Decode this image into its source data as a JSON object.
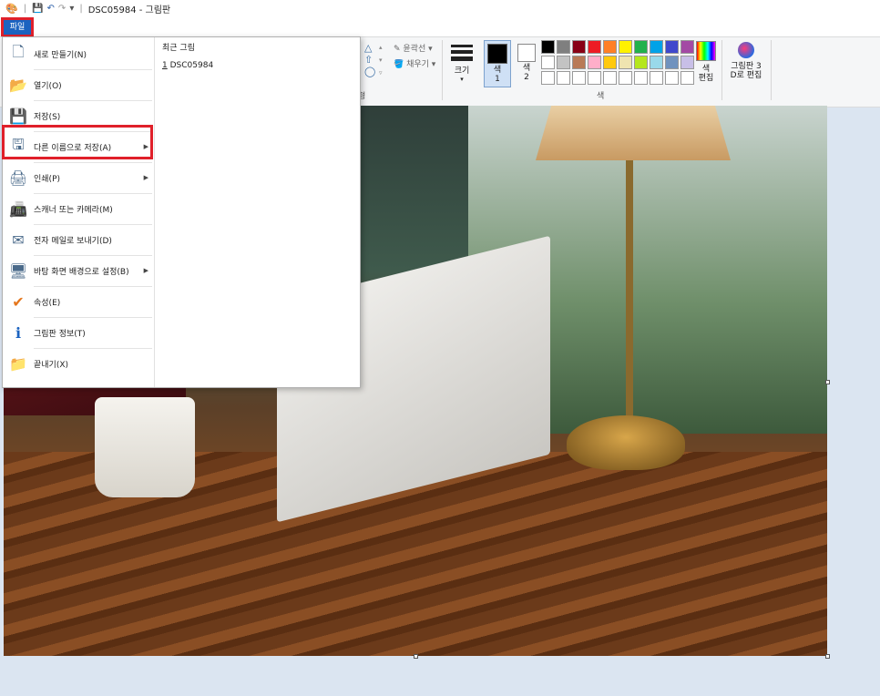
{
  "window": {
    "title": "DSC05984 - 그림판"
  },
  "ribbon": {
    "file_tab": "파일",
    "outline_label": "윤곽선",
    "fill_label": "채우기",
    "shapes_group": "형",
    "size_label": "크기",
    "color1_label": "색\n1",
    "color2_label": "색\n2",
    "colors_group": "색",
    "edit_colors": "색\n편집",
    "paint3d": "그림판 3\nD로 편집",
    "palette": [
      "#000000",
      "#7f7f7f",
      "#880015",
      "#ed1c24",
      "#ff7f27",
      "#fff200",
      "#22b14c",
      "#00a2e8",
      "#3f48cc",
      "#a349a4",
      "#ffffff",
      "#c3c3c3",
      "#b97a57",
      "#ffaec9",
      "#ffc90e",
      "#efe4b0",
      "#b5e61d",
      "#99d9ea",
      "#7092be",
      "#c8bfe7",
      "#ffffff",
      "#ffffff",
      "#ffffff",
      "#ffffff",
      "#ffffff",
      "#ffffff",
      "#ffffff",
      "#ffffff",
      "#ffffff",
      "#ffffff"
    ]
  },
  "file_menu": {
    "items": [
      {
        "label": "새로 만들기(N)",
        "icon": "new-file-icon",
        "submenu": false
      },
      {
        "label": "열기(O)",
        "icon": "open-folder-icon",
        "submenu": false
      },
      {
        "label": "저장(S)",
        "icon": "save-disk-icon",
        "submenu": false
      },
      {
        "label": "다른 이름으로 저장(A)",
        "icon": "save-as-icon",
        "submenu": true
      },
      {
        "label": "인쇄(P)",
        "icon": "printer-icon",
        "submenu": true
      },
      {
        "label": "스캐너 또는 카메라(M)",
        "icon": "scanner-icon",
        "submenu": false
      },
      {
        "label": "전자 메일로 보내기(D)",
        "icon": "email-icon",
        "submenu": false
      },
      {
        "label": "바탕 화면 배경으로 설정(B)",
        "icon": "desktop-background-icon",
        "submenu": true
      },
      {
        "label": "속성(E)",
        "icon": "checkmark-icon",
        "submenu": false
      },
      {
        "label": "그림판 정보(T)",
        "icon": "info-icon",
        "submenu": false
      },
      {
        "label": "끝내기(X)",
        "icon": "exit-folder-icon",
        "submenu": false
      }
    ],
    "recent_title": "최근 그림",
    "recent_items": [
      {
        "index": "1",
        "name": "DSC05984"
      }
    ]
  },
  "colors": {
    "accent": "#1b63c0",
    "highlight": "#e0202a"
  }
}
